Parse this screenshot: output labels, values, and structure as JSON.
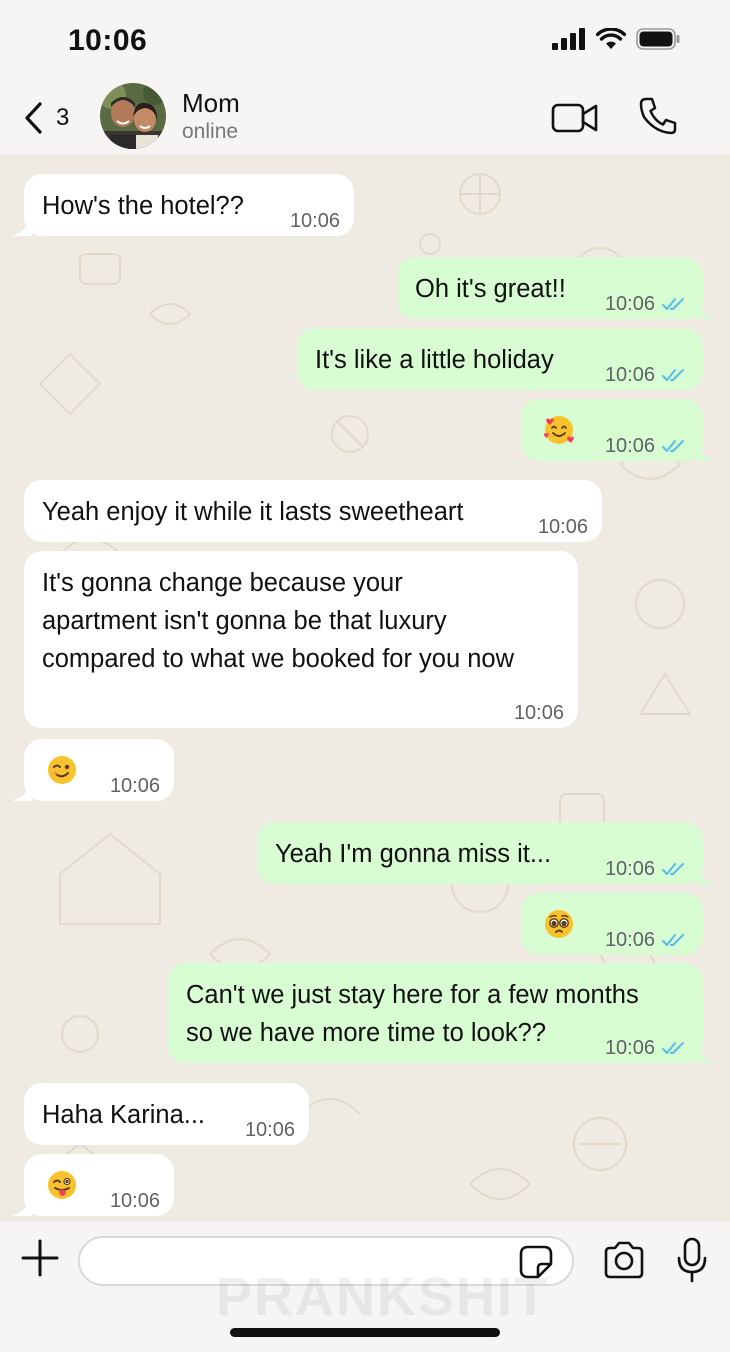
{
  "status_bar": {
    "time": "10:06"
  },
  "header": {
    "back_count": "3",
    "contact_name": "Mom",
    "contact_status": "online"
  },
  "watermark": "PRANKSHIT",
  "messages": [
    {
      "direction": "in",
      "text": "How's the hotel??",
      "time": "10:06"
    },
    {
      "direction": "out",
      "text": "Oh it's great!!",
      "time": "10:06",
      "read": true
    },
    {
      "direction": "out",
      "text": "It's like a little holiday",
      "time": "10:06",
      "read": true
    },
    {
      "direction": "out",
      "emoji": "smiling-face-with-hearts",
      "time": "10:06",
      "read": true
    },
    {
      "direction": "in",
      "text": "Yeah enjoy it while it lasts sweetheart",
      "time": "10:06"
    },
    {
      "direction": "in",
      "lines": [
        "It's gonna change because your",
        "apartment isn't gonna be that luxury",
        "compared to what we booked for you now"
      ],
      "time": "10:06"
    },
    {
      "direction": "in",
      "emoji": "winking-face",
      "time": "10:06"
    },
    {
      "direction": "out",
      "text": "Yeah I'm gonna miss it...",
      "time": "10:06",
      "read": true
    },
    {
      "direction": "out",
      "emoji": "pleading-face",
      "time": "10:06",
      "read": true
    },
    {
      "direction": "out",
      "lines": [
        "Can't we just stay here for a few months",
        "so we have more time to look??"
      ],
      "time": "10:06",
      "read": true
    },
    {
      "direction": "in",
      "text": "Haha Karina...",
      "time": "10:06"
    },
    {
      "direction": "in",
      "emoji": "winking-face-with-tongue",
      "time": "10:06"
    }
  ],
  "composer": {
    "placeholder": ""
  },
  "colors": {
    "incoming_bubble": "#ffffff",
    "outgoing_bubble": "#d9fdd3",
    "read_tick": "#53bdeb",
    "chat_background": "#f0ebe2"
  }
}
